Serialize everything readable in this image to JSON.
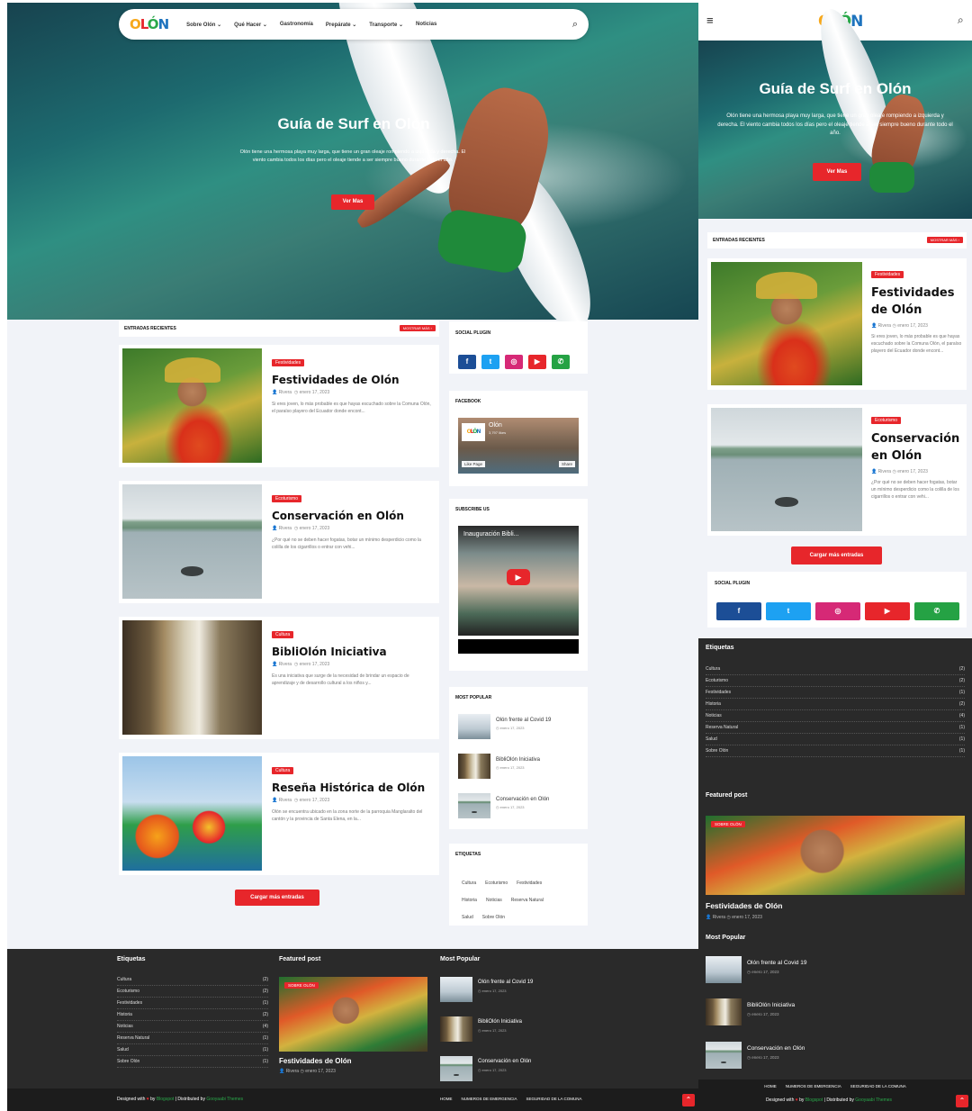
{
  "site": {
    "logo": {
      "o1": "O",
      "l": "L",
      "o2": "Ó",
      "n": "N"
    }
  },
  "nav": {
    "items": [
      "Sobre Olón",
      "Qué Hacer",
      "Gastronomía",
      "Prepárate",
      "Transporte",
      "Noticias"
    ],
    "chevron": "⌄"
  },
  "hero": {
    "title": "Guía de Surf en Olón",
    "text": "Olón tiene una hermosa playa muy larga, que tiene un gran oleaje rompiendo a izquierda y derecha. El viento cambia todos los días pero el oleaje tiende a ser siempre bueno durante todo el año.",
    "button": "Ver Mas"
  },
  "recent": {
    "heading": "ENTRADAS RECIENTES",
    "more": "MOSTRAR MÁS ›"
  },
  "posts": [
    {
      "tag": "Festividades",
      "title": "Festividades de Olón",
      "author": "Rivera",
      "date": "enero 17, 2023",
      "snippet": "Si eres joven, lo más probable es que hayas escuchado sobre la Comuna Olón, el paraíso playero del Ecuador donde encont..."
    },
    {
      "tag": "Ecoturismo",
      "title": "Conservación en Olón",
      "author": "Rivera",
      "date": "enero 17, 2023",
      "snippet": "¿Por qué no se deben hacer fogatas, botar un mínimo desperdicio como la colilla de los cigarrillos o entrar con vehi..."
    },
    {
      "tag": "Cultura",
      "title": "BibliOlón Iniciativa",
      "author": "Rivera",
      "date": "enero 17, 2023",
      "snippet": "Es una iniciativa que surge de la necesidad de brindar un espacio de aprendizaje y de desarrollo cultural a los niños y..."
    },
    {
      "tag": "Cultura",
      "title": "Reseña Histórica de Olón",
      "author": "Rivera",
      "date": "enero 17, 2023",
      "snippet": "Olón se encuentra ubicado en la zona norte de la parroquia Manglaralto del cantón y la provincia de Santa Elena, en la..."
    }
  ],
  "load_more": "Cargar más entradas",
  "sidebar": {
    "social_heading": "SOCIAL PLUGIN",
    "social_icons": [
      {
        "name": "facebook-icon",
        "glyph": "f",
        "color": "#1c4e96"
      },
      {
        "name": "twitter-icon",
        "glyph": "t",
        "color": "#1da1f2"
      },
      {
        "name": "instagram-icon",
        "glyph": "◎",
        "color": "#d62976"
      },
      {
        "name": "youtube-icon",
        "glyph": "▶",
        "color": "#e7262b"
      },
      {
        "name": "whatsapp-icon",
        "glyph": "✆",
        "color": "#25a244"
      }
    ],
    "facebook_heading": "FACEBOOK",
    "fb": {
      "page_name": "Olón",
      "likes": "3,797 likes",
      "like_btn": "Like Page",
      "share_btn": "Share"
    },
    "subscribe_heading": "SUBSCRIBE US",
    "video_title": "Inauguración Bibli...",
    "popular_heading": "MOST POPULAR",
    "popular": [
      {
        "title": "Olón frente al Covid 19",
        "date": "enero 17, 2023"
      },
      {
        "title": "BibliOlón Iniciativa",
        "date": "enero 17, 2023"
      },
      {
        "title": "Conservación en Olón",
        "date": "enero 17, 2023"
      }
    ],
    "labels_heading": "ETIQUETAS",
    "tags": [
      "Cultura",
      "Ecoturismo",
      "Festividades",
      "Historia",
      "Noticias",
      "Reserva Natural",
      "Salud",
      "Sobre Olón"
    ]
  },
  "footer": {
    "labels_heading": "Etiquetas",
    "labels": [
      {
        "name": "Cultura",
        "count": "(2)"
      },
      {
        "name": "Ecoturismo",
        "count": "(2)"
      },
      {
        "name": "Festividades",
        "count": "(1)"
      },
      {
        "name": "Historia",
        "count": "(2)"
      },
      {
        "name": "Noticias",
        "count": "(4)"
      },
      {
        "name": "Reserva Natural",
        "count": "(1)"
      },
      {
        "name": "Salud",
        "count": "(1)"
      },
      {
        "name": "Sobre Olón",
        "count": "(1)"
      }
    ],
    "featured_heading": "Featured post",
    "featured": {
      "badge": "SOBRE OLÓN",
      "title": "Festividades de Olón",
      "author": "Rivera",
      "date": "enero 17, 2023"
    },
    "popular_heading": "Most Popular",
    "popular": [
      {
        "title": "Olón frente al Covid 19",
        "date": "enero 17, 2023"
      },
      {
        "title": "BibliOlón Iniciativa",
        "date": "enero 17, 2023"
      },
      {
        "title": "Conservación en Olón",
        "date": "enero 17, 2023"
      }
    ],
    "credit_designed": "Designed with",
    "credit_by": "by",
    "credit_blogspot": "Blogspot",
    "credit_sep": "|",
    "credit_dist": "Distributed by",
    "credit_theme": "Gooyaabi Themes",
    "links": [
      "HOME",
      "NUMEROS DE EMERGENCIA",
      "SEGURIDAD DE LA COMUNA"
    ]
  },
  "mobile": {
    "menu_icon": "≡",
    "search_icon": "⌕"
  },
  "colors": {
    "accent": "#e7262b",
    "dark": "#2a2a2a",
    "green_link": "#2aa84a"
  }
}
